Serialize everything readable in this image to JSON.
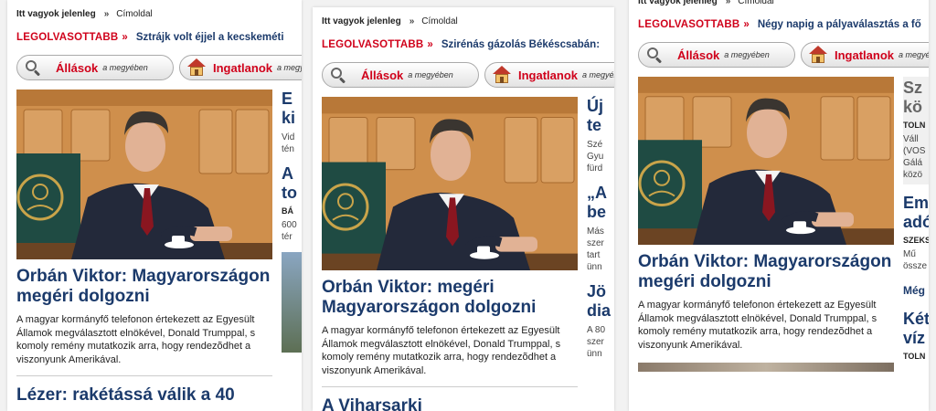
{
  "breadcrumb": {
    "here": "Itt vagyok jelenleg",
    "separator": "»",
    "current": "Címoldal"
  },
  "ticker_label": "LEGOLVASOTTABB",
  "ticker_arrow": "»",
  "tabs": {
    "jobs": {
      "main": "Állások",
      "sub": "a megyében",
      "icon": "magnifier-icon"
    },
    "estate": {
      "main": "Ingatlanok",
      "sub": "a megyében",
      "icon": "house-icon"
    }
  },
  "lead_text": "A magyar kormányfő telefonon értekezett az Egyesült Államok megválasztott elnökével, Donald Trumppal, s komoly remény mutatkozik arra, hogy rendezõdhet a viszonyunk Amerikával.",
  "colors": {
    "accent_red": "#d0021b",
    "headline_blue": "#1b3a6b"
  },
  "panels": [
    {
      "ticker_headline": "Sztrájk volt éjjel a kecskeméti",
      "lead_title": "Orbán Viktor: Magyarországon megéri dolgozni",
      "next_title": "Lézer: rakétássá válik a 40",
      "side": [
        {
          "title": "E\nki",
          "text": "Vid\ntén"
        },
        {
          "title": "A\nto",
          "kicker": "BÁ",
          "text": "600\ntér"
        }
      ]
    },
    {
      "ticker_headline": "Szirénás gázolás Békéscsabán:",
      "lead_title": "Orbán Viktor: megéri Magyarországon dolgozni",
      "next_title": "A Viharsarki",
      "side": [
        {
          "title": "Új\nte",
          "text": "Szé\nGyu\nfürd"
        },
        {
          "title": "„A\nbe",
          "text": "Más\nszer\ntart\nünn"
        },
        {
          "title": "Jö\ndia",
          "text": "A 80\nszer\nünn"
        }
      ]
    },
    {
      "ticker_headline": "Négy napig a pályaválasztás a fő",
      "lead_title": "Orbán Viktor: Magyarországon megéri dolgozni",
      "next_title": "",
      "side": [
        {
          "title": "Sz\nkö",
          "kicker": "TOLN",
          "text": "Váll\n(VOS\nGálá\nközö"
        },
        {
          "title": "Em\nadó",
          "kicker": "SZEKS",
          "text": "Mű\nössze"
        },
        {
          "title": "Még",
          "text": ""
        },
        {
          "title": "Két\nvíz",
          "kicker": "TOLN",
          "text": ""
        }
      ]
    }
  ]
}
